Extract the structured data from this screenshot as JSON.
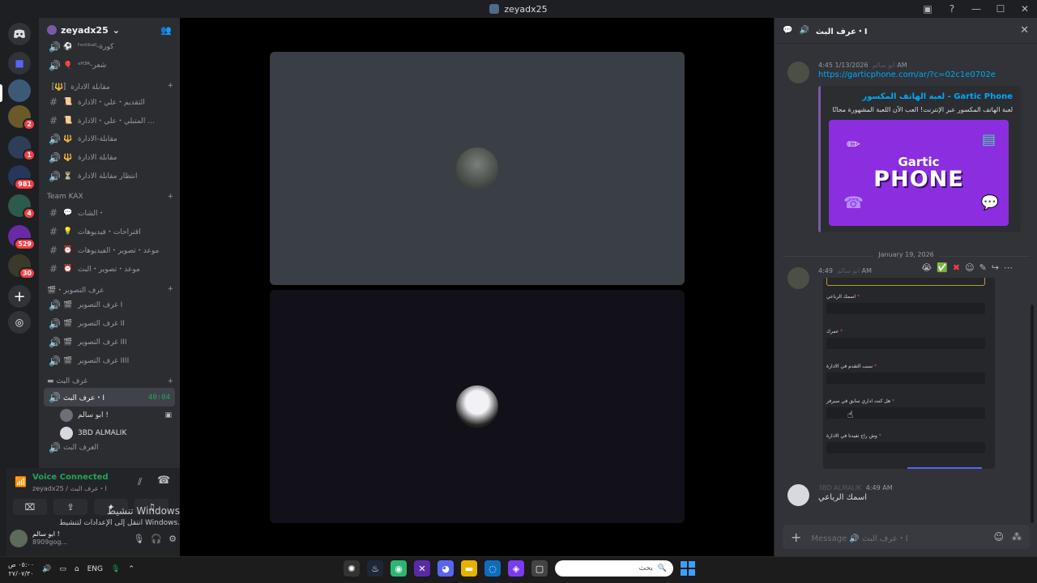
{
  "window": {
    "title": "zeyadx25",
    "controls": [
      "▣",
      "?",
      "—",
      "☐",
      "✕"
    ]
  },
  "rail": {
    "badges": [
      "2",
      "1",
      "981",
      "4",
      "529",
      "30"
    ],
    "add_label": "+",
    "explore_label": "◎"
  },
  "sidebar": {
    "server_name": "zeyadx25",
    "channels_top": [
      {
        "sym": "🔊",
        "emo": "⚽",
        "label": "ᶠᵒᵒᵗᵇᵃˡˡ-كورة"
      },
      {
        "sym": "🔊",
        "emo": "🎈",
        "label": "ˢᴴ³ᴿ-شعر"
      }
    ],
    "cat_admin": "〚🔱〛مقابلة الادارة",
    "channels_admin": [
      {
        "sym": "#",
        "emo": "📜",
        "label": "التقديم・علي・الادارة"
      },
      {
        "sym": "#",
        "emo": "📜",
        "label": "المتبلي・علي・الادارة ..."
      },
      {
        "sym": "🔊",
        "emo": "🔱",
        "label": "مقابلة-الادارة"
      },
      {
        "sym": "🔊",
        "emo": "🔱",
        "label": "مقابلة الادارة"
      },
      {
        "sym": "🔊",
        "emo": "⏳",
        "label": "انتظار مقابلة الادارة"
      }
    ],
    "cat_team": "Team KAX",
    "channels_team": [
      {
        "sym": "#",
        "emo": "💬",
        "label": "الشات・"
      },
      {
        "sym": "#",
        "emo": "💡",
        "label": "اقتراحات・فيديوهات"
      },
      {
        "sym": "#",
        "emo": "⏰",
        "label": "موعد・تصوير・الفيديوهات"
      },
      {
        "sym": "#",
        "emo": "⏰",
        "label": "موعد・تصوير・البث"
      }
    ],
    "cat_rooms": "🎬・غرف التصوير",
    "channels_rooms": [
      {
        "sym": "🔊",
        "emo": "🎬",
        "label": "غرف التصوير I"
      },
      {
        "sym": "🔊",
        "emo": "🎬",
        "label": "غرف التصوير II"
      },
      {
        "sym": "🔊",
        "emo": "🎬",
        "label": "غرف التصوير III"
      },
      {
        "sym": "🔊",
        "emo": "🎬",
        "label": "غرف التصوير IIII"
      }
    ],
    "cat_stream": "▬ غرف البث",
    "active_channel": {
      "label": "عرف البث・I",
      "timer": "40:04"
    },
    "members": [
      "ابو سالم !",
      "3BD ALMALIK"
    ],
    "cut_item": "الغرف البث"
  },
  "voice": {
    "status": "Voice Connected",
    "sub": "zeyadx25 / عرف البث・I",
    "user_name": "ابو سالم !",
    "user_sub": "8909gog..."
  },
  "activate": {
    "line1": "تنشيط Windows",
    "line2": "انتقل إلى الإعدادات لتنشيط Windows."
  },
  "chat": {
    "header": "عرف البث・I",
    "msg1": {
      "time": "1/13/2026 4:45 AM",
      "author": "ابو سالم",
      "link": "https://garticphone.com/ar/?c=02c1e0702e",
      "embed_title": "لعبة الهاتف المكسور - Gartic Phone",
      "embed_desc": "لعبة الهاتف المكسور عبر الإنترنت! العب الآن اللعبة المشهورة مجانًا",
      "logo_top": "Gartic",
      "logo_bottom": "PHONE"
    },
    "date_sep": "January 19, 2026",
    "msg2": {
      "time": "4:49 AM",
      "author": "ابو سالم"
    },
    "form_fields": [
      "اسمك الرباعي",
      "عمرك",
      "سبب التقدم في الادارة",
      "هل كنت اداري سابق في سيرفر",
      "وش راح تفيدنا في الادارة"
    ],
    "msg3": {
      "author": "3BD ALMALIK",
      "time": "4:49 AM",
      "text": "اسمك الرباعي"
    },
    "composer_placeholder": "Message 🔊 عرف البث・I"
  },
  "taskbar": {
    "time": "٠٥:٠٠ ص",
    "date": "٢٧/٠٧/٣٠",
    "lang": "ENG",
    "search_placeholder": "بحث"
  }
}
